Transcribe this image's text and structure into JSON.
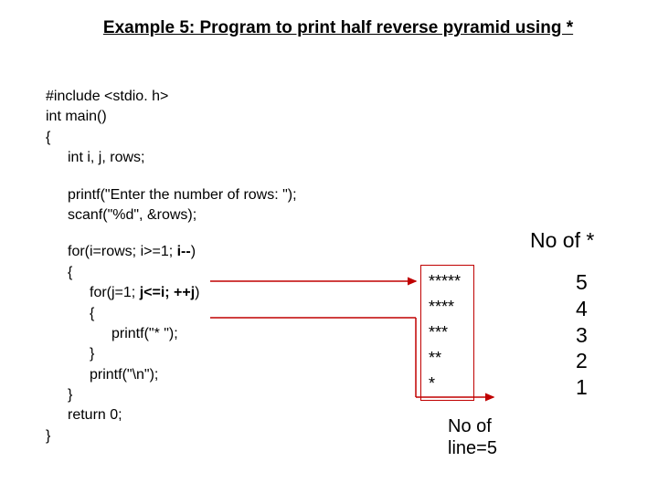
{
  "title": "Example 5: Program to print half reverse pyramid using *",
  "code": {
    "l1": "#include <stdio. h>",
    "l2": "int main()",
    "l3": "{",
    "l4": "int i, j, rows;",
    "l5": "printf(\"Enter the number of rows: \");",
    "l6": "scanf(\"%d\", &rows);",
    "l7a": "for(i=rows; i>=1; ",
    "l7b": "i--",
    "l7c": ")",
    "l8": "{",
    "l9a": "for(j=1; ",
    "l9b": "j<=i; ++j",
    "l9c": ")",
    "l10": "{",
    "l11": "printf(\"* \");",
    "l12": "}",
    "l13": "printf(\"\\n\");",
    "l14": "}",
    "l15": "return 0;",
    "l16": "}"
  },
  "pyramid": {
    "r1": "*****",
    "r2": "****",
    "r3": "***",
    "r4": "**",
    "r5": "*"
  },
  "labels": {
    "no_of_star": "No of *",
    "no_of_line_a": "No of",
    "no_of_line_b": "line=5"
  },
  "counts": {
    "n1": "5",
    "n2": "4",
    "n3": "3",
    "n4": "2",
    "n5": "1"
  },
  "colors": {
    "accent": "#c00000"
  }
}
